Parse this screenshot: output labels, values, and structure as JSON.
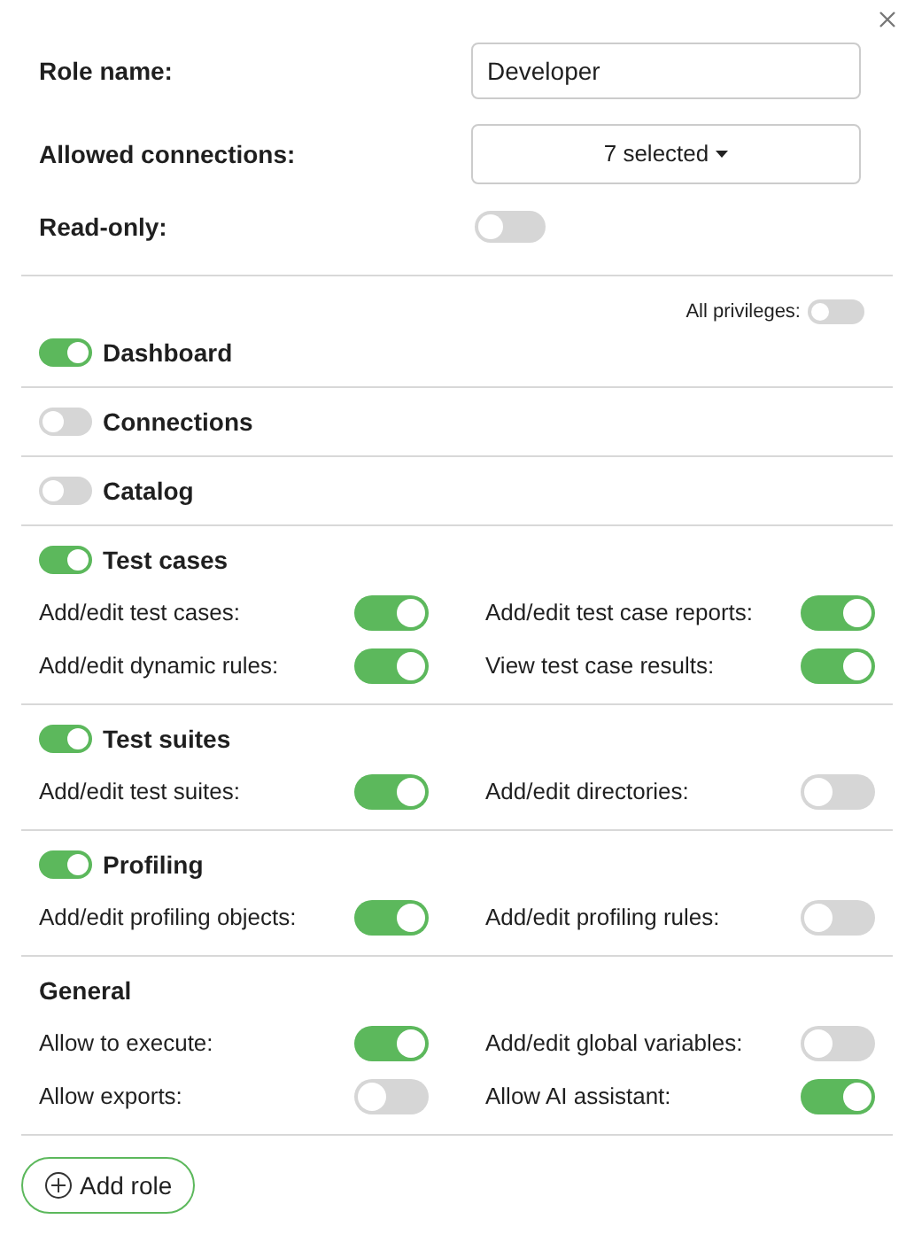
{
  "role_name": {
    "label": "Role name:",
    "value": "Developer"
  },
  "allowed_connections": {
    "label": "Allowed connections:",
    "value": "7 selected"
  },
  "read_only": {
    "label": "Read-only:",
    "on": false
  },
  "all_privileges": {
    "label": "All privileges:",
    "on": false
  },
  "sections": [
    {
      "title": "Dashboard",
      "kind": "toggle",
      "on": true
    },
    {
      "title": "Connections",
      "kind": "toggle",
      "on": false
    },
    {
      "title": "Catalog",
      "kind": "toggle",
      "on": false
    },
    {
      "title": "Test cases",
      "kind": "toggle",
      "on": true,
      "permissions": [
        {
          "label": "Add/edit test cases:",
          "on": true
        },
        {
          "label": "Add/edit test case reports:",
          "on": true
        },
        {
          "label": "Add/edit dynamic rules:",
          "on": true
        },
        {
          "label": "View test case results:",
          "on": true
        }
      ]
    },
    {
      "title": "Test suites",
      "kind": "toggle",
      "on": true,
      "permissions": [
        {
          "label": "Add/edit test suites:",
          "on": true
        },
        {
          "label": "Add/edit directories:",
          "on": false
        }
      ]
    },
    {
      "title": "Profiling",
      "kind": "toggle",
      "on": true,
      "permissions": [
        {
          "label": "Add/edit profiling objects:",
          "on": true
        },
        {
          "label": "Add/edit profiling rules:",
          "on": false
        }
      ]
    },
    {
      "title": "General",
      "kind": "plain",
      "permissions": [
        {
          "label": "Allow to execute:",
          "on": true
        },
        {
          "label": "Add/edit global variables:",
          "on": false
        },
        {
          "label": "Allow exports:",
          "on": false
        },
        {
          "label": "Allow AI assistant:",
          "on": true
        }
      ]
    }
  ],
  "add_button": "Add role"
}
